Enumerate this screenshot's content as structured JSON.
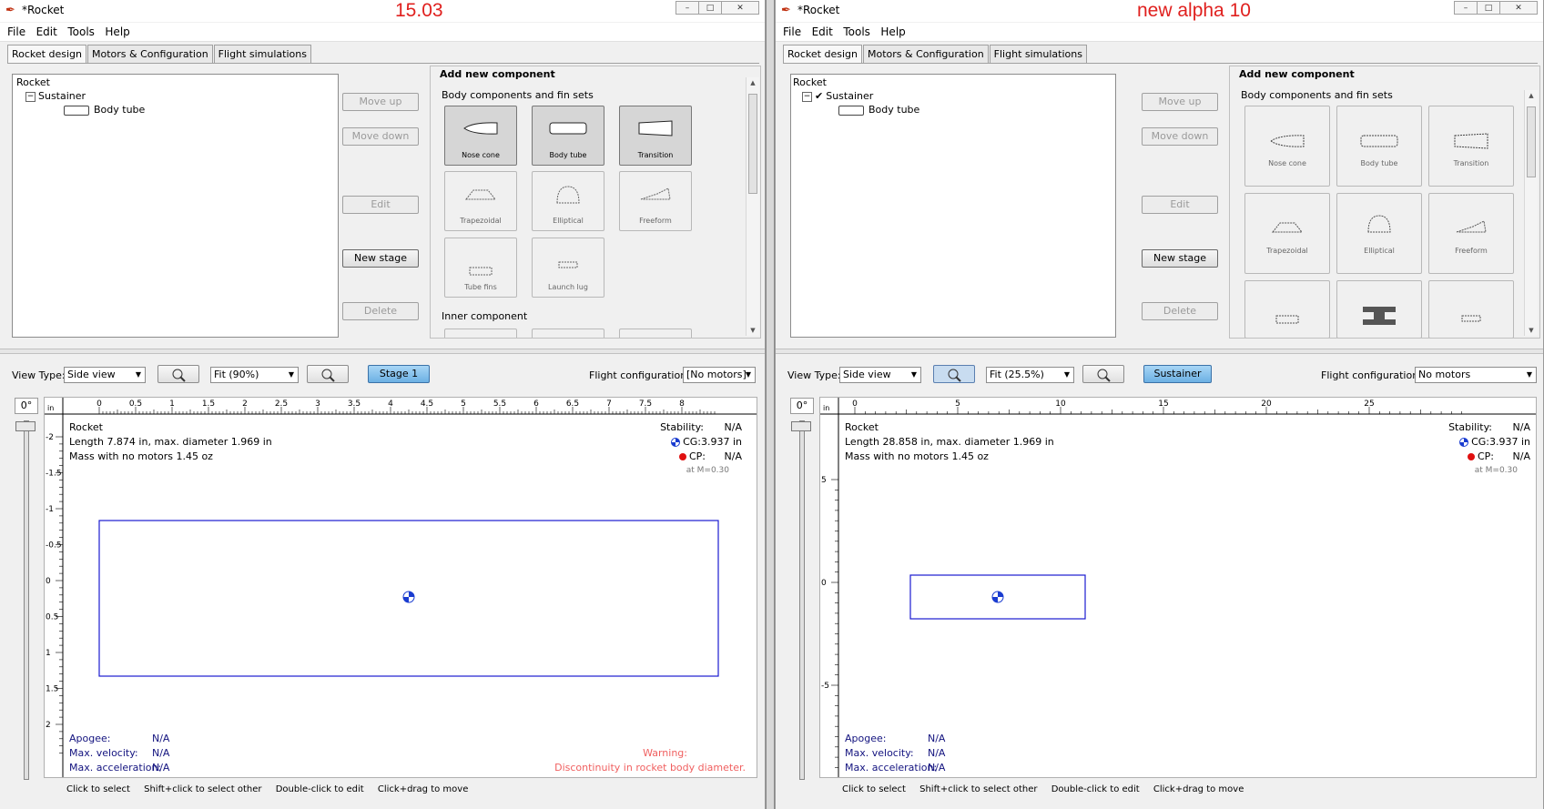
{
  "left": {
    "title": "*Rocket",
    "version_label": "15.03",
    "menu": [
      "File",
      "Edit",
      "Tools",
      "Help"
    ],
    "tabs": [
      "Rocket design",
      "Motors & Configuration",
      "Flight simulations"
    ],
    "tree": {
      "root": "Rocket",
      "stage": "Sustainer",
      "component": "Body tube"
    },
    "buttons": {
      "move_up": "Move up",
      "move_down": "Move down",
      "edit": "Edit",
      "new_stage": "New stage",
      "delete": "Delete"
    },
    "add_component": {
      "title": "Add new component",
      "body_section": "Body components and fin sets",
      "inner_section": "Inner component",
      "items": [
        "Nose cone",
        "Body tube",
        "Transition",
        "Trapezoidal",
        "Elliptical",
        "Freeform",
        "Tube fins",
        "Launch lug"
      ]
    },
    "view_bar": {
      "view_type_label": "View Type:",
      "view_type_value": "Side view",
      "fit_value": "Fit (90%)",
      "stage_button": "Stage 1",
      "flight_config_label": "Flight configuration:",
      "flight_config_value": "[No motors]"
    },
    "angle": "0°",
    "ruler_unit": "in",
    "top_ticks": [
      "0",
      "0.5",
      "1",
      "1.5",
      "2",
      "2.5",
      "3",
      "3.5",
      "4",
      "4.5",
      "5",
      "5.5",
      "6",
      "6.5",
      "7",
      "7.5",
      "8"
    ],
    "left_ticks": [
      "-2",
      "-1.5",
      "-1",
      "-0.5",
      "0",
      "0.5",
      "1",
      "1.5",
      "2"
    ],
    "info": {
      "name": "Rocket",
      "length": "Length 7.874 in, max. diameter 1.969 in",
      "mass": "Mass with no motors 1.45 oz",
      "stability_label": "Stability:",
      "stability_value": "N/A",
      "cg": "CG:3.937 in",
      "cp_label": "CP:",
      "cp_value": "N/A",
      "mach": "at M=0.30"
    },
    "results": {
      "apogee_label": "Apogee:",
      "apogee": "N/A",
      "velocity_label": "Max. velocity:",
      "velocity": "N/A",
      "accel_label": "Max. acceleration:",
      "accel": "N/A"
    },
    "warning": {
      "title": "Warning:",
      "text": "Discontinuity in rocket body diameter."
    },
    "hints": [
      "Click to select",
      "Shift+click to select other",
      "Double-click to edit",
      "Click+drag to move"
    ]
  },
  "right": {
    "title": "*Rocket",
    "version_label": "new alpha 10",
    "menu": [
      "File",
      "Edit",
      "Tools",
      "Help"
    ],
    "tabs": [
      "Rocket design",
      "Motors & Configuration",
      "Flight simulations"
    ],
    "tree": {
      "root": "Rocket",
      "stage": "Sustainer",
      "component": "Body tube"
    },
    "buttons": {
      "move_up": "Move up",
      "move_down": "Move down",
      "edit": "Edit",
      "new_stage": "New stage",
      "delete": "Delete"
    },
    "add_component": {
      "title": "Add new component",
      "body_section": "Body components and fin sets",
      "items": [
        "Nose cone",
        "Body tube",
        "Transition",
        "Trapezoidal",
        "Elliptical",
        "Freeform"
      ]
    },
    "view_bar": {
      "view_type_label": "View Type:",
      "view_type_value": "Side view",
      "fit_value": "Fit (25.5%)",
      "stage_button": "Sustainer",
      "flight_config_label": "Flight configuration:",
      "flight_config_value": "No motors"
    },
    "angle": "0°",
    "ruler_unit": "in",
    "top_ticks": [
      "0",
      "5",
      "10",
      "15",
      "20",
      "25"
    ],
    "left_ticks": [
      "5",
      "0",
      "-5"
    ],
    "info": {
      "name": "Rocket",
      "length": "Length 28.858 in, max. diameter 1.969 in",
      "mass": "Mass with no motors 1.45 oz",
      "stability_label": "Stability:",
      "stability_value": "N/A",
      "cg": "CG:3.937 in",
      "cp_label": "CP:",
      "cp_value": "N/A",
      "mach": "at M=0.30"
    },
    "results": {
      "apogee_label": "Apogee:",
      "apogee": "N/A",
      "velocity_label": "Max. velocity:",
      "velocity": "N/A",
      "accel_label": "Max. acceleration:",
      "accel": "N/A"
    },
    "hints": [
      "Click to select",
      "Shift+click to select other",
      "Double-click to edit",
      "Click+drag to move"
    ]
  },
  "colors": {
    "version_label": "#e0201e",
    "rocket_outline": "#1a1ad0",
    "info_blue": "#13137f",
    "warning": "#f06060",
    "stage_button": "#6cb0e4"
  }
}
